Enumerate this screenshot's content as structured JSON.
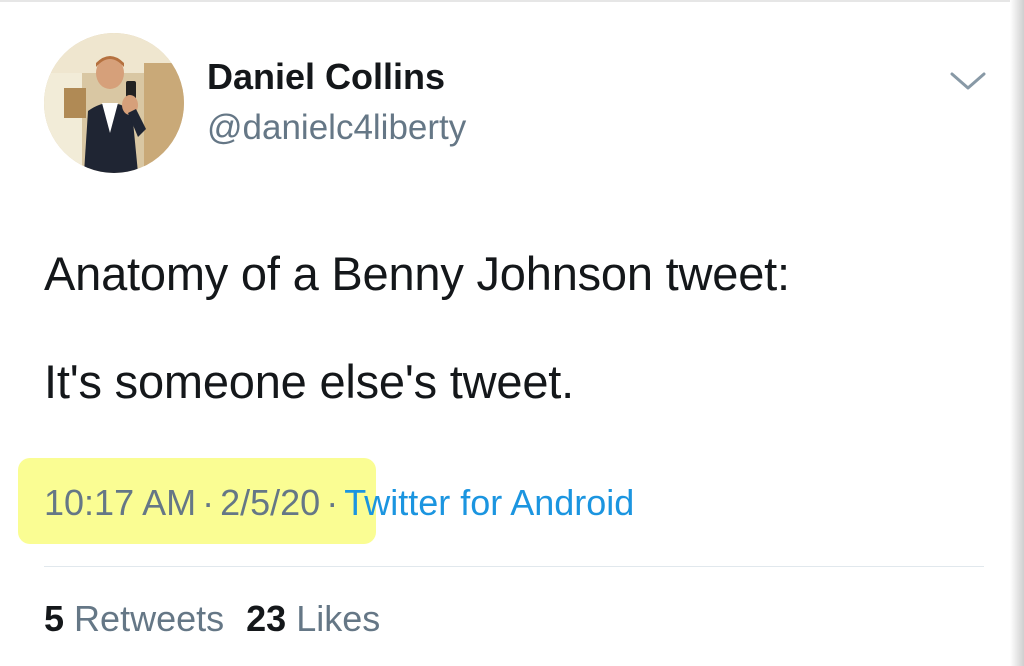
{
  "tweet": {
    "author": {
      "display_name": "Daniel Collins",
      "handle": "@danielc4liberty"
    },
    "text_lines": [
      "Anatomy of a Benny Johnson tweet:",
      "It's someone else's tweet."
    ],
    "meta": {
      "time": "10:17 AM",
      "separator": "·",
      "date": "2/5/20",
      "source": "Twitter for Android"
    },
    "stats": {
      "retweets_count": "5",
      "retweets_label": "Retweets",
      "likes_count": "23",
      "likes_label": "Likes"
    },
    "menu_icon": "chevron-down-icon"
  },
  "colors": {
    "text_primary": "#14171a",
    "text_secondary": "#657786",
    "link": "#1b95e0",
    "highlight": "#fafd93",
    "divider": "#e1e8ed"
  }
}
